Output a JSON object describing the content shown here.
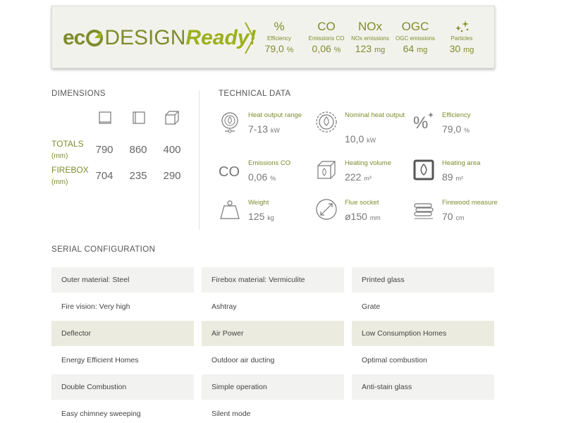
{
  "eco_banner": {
    "logo_eco": "ec",
    "logo_design": "DESIGN",
    "logo_ready": "Ready!",
    "stats": [
      {
        "symbol": "%",
        "label": "Efficiency",
        "value": "79,0",
        "unit": "%"
      },
      {
        "symbol": "CO",
        "label": "Emissions CO",
        "value": "0,06",
        "unit": "%"
      },
      {
        "symbol": "NOx",
        "label": "NOx emissions",
        "value": "123",
        "unit": "mg"
      },
      {
        "symbol": "OGC",
        "label": "OGC emissions",
        "value": "64",
        "unit": "mg"
      },
      {
        "symbol": "particles-icon",
        "label": "Particles",
        "value": "30",
        "unit": "mg"
      }
    ]
  },
  "dimensions": {
    "title": "DIMENSIONS",
    "icons": [
      "width-icon",
      "depth-icon",
      "height-icon"
    ],
    "rows": [
      {
        "label": "TOTALS",
        "unit": "(mm)",
        "values": [
          "790",
          "860",
          "400"
        ]
      },
      {
        "label": "FIREBOX",
        "unit": "(mm)",
        "values": [
          "704",
          "235",
          "290"
        ]
      }
    ]
  },
  "technical": {
    "title": "TECHNICAL DATA",
    "items": [
      {
        "icon": "heat-output-icon",
        "label": "Heat output range",
        "value": "7-13",
        "unit": "kW"
      },
      {
        "icon": "nominal-output-icon",
        "label": "Nominal heat output",
        "value": "10,0",
        "unit": "kW"
      },
      {
        "icon": "efficiency-icon",
        "label": "Efficiency",
        "value": "79,0",
        "unit": "%"
      },
      {
        "icon": "co-icon",
        "label": "Emissions CO",
        "value": "0,06",
        "unit": "%"
      },
      {
        "icon": "heating-volume-icon",
        "label": "Heating volume",
        "value": "222",
        "unit": "m³"
      },
      {
        "icon": "heating-area-icon",
        "label": "Heating area",
        "value": "89",
        "unit": "m²"
      },
      {
        "icon": "weight-icon",
        "label": "Weight",
        "value": "125",
        "unit": "kg"
      },
      {
        "icon": "flue-socket-icon",
        "label": "Flue socket",
        "value": "ø150",
        "unit": "mm"
      },
      {
        "icon": "firewood-icon",
        "label": "Firewood measure",
        "value": "70",
        "unit": "cm"
      }
    ]
  },
  "serial": {
    "title": "SERIAL CONFIGURATION",
    "rows": [
      [
        "Outer material: Steel",
        "Firebox material: Vermiculite",
        "Printed glass"
      ],
      [
        "Fire vision: Very high",
        "Ashtray",
        "Grate"
      ],
      [
        "Deflector",
        "Air Power",
        "Low Consumption Homes"
      ],
      [
        "Energy Efficient Homes",
        "Outdoor air ducting",
        "Optimal combustion"
      ],
      [
        "Double Combustion",
        "Simple operation",
        "Anti-stain glass"
      ],
      [
        "Easy chimney sweeping",
        "Silent mode",
        ""
      ]
    ]
  },
  "colors": {
    "accent": "#7f8c2c",
    "accent_light": "#9cb01c",
    "row_grey": "#f2f2f0",
    "row_olive": "#ebebdf"
  }
}
